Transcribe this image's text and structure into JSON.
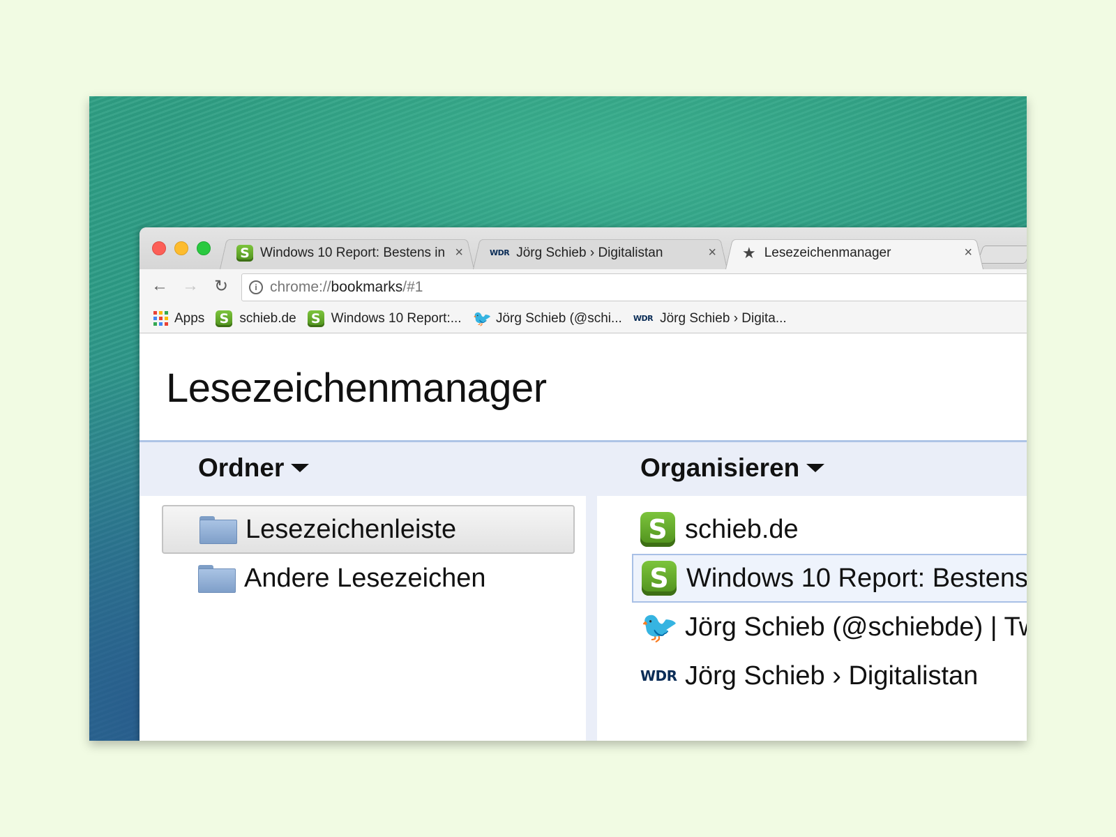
{
  "tabs": [
    {
      "label": "Windows 10 Report: Bestens in",
      "favicon": "schieb-s-icon",
      "close": "×"
    },
    {
      "label": "Jörg Schieb › Digitalistan",
      "favicon": "wdr-icon",
      "close": "×"
    },
    {
      "label": "Lesezeichenmanager",
      "favicon": "star-icon",
      "close": "×",
      "active": true
    }
  ],
  "toolbar": {
    "back": "←",
    "forward": "→",
    "reload": "↻",
    "url_scheme": "chrome://",
    "url_host": "bookmarks",
    "url_rest": "/#1",
    "info": "i"
  },
  "bookmarks_bar": {
    "apps": "Apps",
    "items": [
      {
        "label": "schieb.de",
        "icon": "schieb-s-icon"
      },
      {
        "label": "Windows 10 Report:...",
        "icon": "schieb-s-icon"
      },
      {
        "label": "Jörg Schieb (@schi...",
        "icon": "twitter-icon"
      },
      {
        "label": "Jörg Schieb › Digita...",
        "icon": "wdr-icon"
      }
    ]
  },
  "page": {
    "title": "Lesezeichenmanager",
    "folders_header": "Ordner",
    "organize_header": "Organisieren",
    "folders": [
      "Lesezeichenleiste",
      "Andere Lesezeichen"
    ],
    "bookmarks": [
      {
        "label": "schieb.de",
        "icon": "schieb-s-icon"
      },
      {
        "label": "Windows 10 Report: Bestens",
        "icon": "schieb-s-icon"
      },
      {
        "label": "Jörg Schieb (@schiebde) | Tw",
        "icon": "twitter-icon"
      },
      {
        "label": "Jörg Schieb › Digitalistan",
        "icon": "wdr-icon"
      }
    ]
  },
  "icons": {
    "s": "S",
    "wdr": "WDR",
    "star": "★",
    "bird": "🐦"
  },
  "colors": {
    "background": "#f1fbe3",
    "accent": "#aec4e6",
    "header_bar": "#eaeef8",
    "schieb_green": "#5fa829",
    "twitter_blue": "#2aa3ef"
  }
}
